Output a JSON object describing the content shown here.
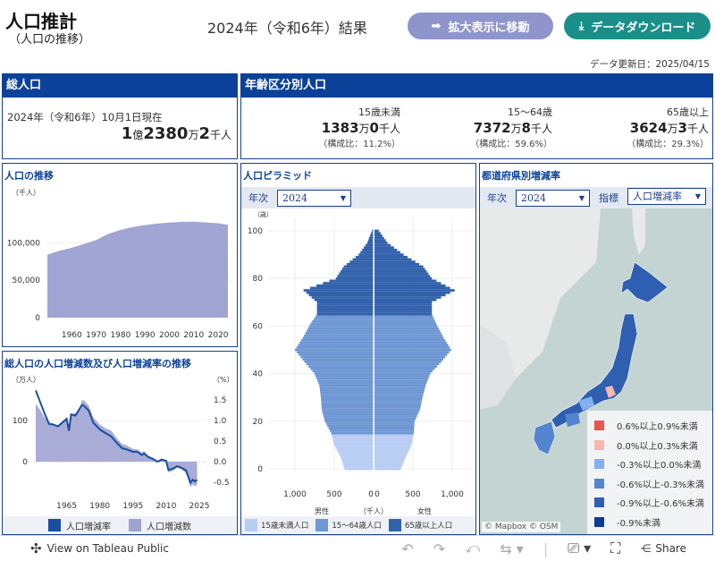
{
  "header": {
    "title": "人口推計",
    "subtitle": "（人口の推移）",
    "result": "2024年（令和6年）結果",
    "expand_button": "拡大表示に移動",
    "download_button": "データダウンロード",
    "updated": "データ更新日：2025/04/15"
  },
  "total": {
    "heading": "総人口",
    "date": "2024年（令和6年）10月1日現在",
    "oku": "1",
    "oku_unit": "億",
    "man": "2380",
    "man_unit": "万",
    "sen": "2",
    "sen_unit": "千人"
  },
  "age": {
    "heading": "年齢区分別人口",
    "groups": [
      {
        "label": "15歳未満",
        "man": "1383",
        "sen": "0",
        "ratio": "（構成比：11.2%）"
      },
      {
        "label": "15～64歳",
        "man": "7372",
        "sen": "8",
        "ratio": "（構成比：59.6%）"
      },
      {
        "label": "65歳以上",
        "man": "3624",
        "sen": "3",
        "ratio": "（構成比：29.3%）"
      }
    ],
    "man_unit": "万",
    "sen_unit": "千人"
  },
  "chart_data": [
    {
      "type": "area",
      "title": "人口の推移",
      "ylabel": "（千人）",
      "ylim": [
        0,
        135000
      ],
      "yticks": [
        "0",
        "50,000",
        "100,000"
      ],
      "ytick_values": [
        0,
        50000,
        100000
      ],
      "xticks": [
        "1960",
        "1970",
        "1980",
        "1990",
        "2000",
        "2010",
        "2020"
      ],
      "color": "#a1a5d3",
      "x": [
        1950,
        1955,
        1960,
        1965,
        1970,
        1975,
        1980,
        1985,
        1990,
        1995,
        2000,
        2005,
        2010,
        2015,
        2020,
        2024
      ],
      "values": [
        84100,
        89300,
        93400,
        98300,
        103700,
        111900,
        117100,
        121000,
        123600,
        125600,
        126900,
        127800,
        128100,
        127100,
        126100,
        123800
      ]
    },
    {
      "type": "line",
      "title": "総人口の人口増減数及び人口増減率の推移",
      "ylabel_left": "（万人）",
      "ylabel_right": "（%）",
      "yticks_left": [
        "0",
        "100"
      ],
      "yticks_right": [
        "-0.5",
        "0.0",
        "0.5",
        "1.0",
        "1.5"
      ],
      "xticks": [
        "1965",
        "1980",
        "1995",
        "2010",
        "2025"
      ],
      "ylim_right": [
        -0.8,
        1.85
      ],
      "x": [
        1951,
        1953,
        1955,
        1957,
        1959,
        1961,
        1963,
        1965,
        1966,
        1967,
        1969,
        1971,
        1972,
        1973,
        1975,
        1977,
        1980,
        1983,
        1985,
        1988,
        1990,
        1992,
        1995,
        1997,
        1999,
        2000,
        2002,
        2004,
        2006,
        2008,
        2010,
        2011,
        2013,
        2015,
        2017,
        2019,
        2021,
        2022,
        2023,
        2024
      ],
      "series": [
        {
          "name": "人口増減率",
          "color": "#1a4ea0",
          "values": [
            1.73,
            1.45,
            1.17,
            0.92,
            0.9,
            0.86,
            0.95,
            1.04,
            0.75,
            1.15,
            1.12,
            1.3,
            1.38,
            1.35,
            1.24,
            0.95,
            0.78,
            0.68,
            0.62,
            0.44,
            0.33,
            0.3,
            0.24,
            0.24,
            0.16,
            0.2,
            0.11,
            0.07,
            0.0,
            0.05,
            0.02,
            -0.2,
            -0.17,
            -0.11,
            -0.15,
            -0.21,
            -0.51,
            -0.44,
            -0.48,
            -0.44
          ]
        },
        {
          "name": "人口増減数",
          "color": "#9fa3d1",
          "values": [
            141,
            125,
            107,
            95,
            93,
            86,
            94,
            105,
            80,
            116,
            118,
            133,
            150,
            148,
            136,
            108,
            90,
            80,
            76,
            55,
            43,
            40,
            31,
            30,
            22,
            26,
            14,
            9,
            2,
            8,
            3,
            -26,
            -22,
            -14,
            -19,
            -28,
            -62,
            -55,
            -60,
            -55
          ]
        }
      ]
    },
    {
      "type": "bar",
      "title": "人口ピラミッド",
      "filter_label": "年次",
      "filter_value": "2024",
      "ylabel": "（歳）",
      "xlabel": "（千人）",
      "male_label": "男性",
      "female_label": "女性",
      "yticks": [
        "0",
        "20",
        "40",
        "60",
        "80",
        "100"
      ],
      "xticks_left": [
        "1,000",
        "500",
        "0"
      ],
      "xticks_right": [
        "0",
        "500",
        "1,000"
      ],
      "ages": [
        0,
        5,
        10,
        15,
        20,
        25,
        30,
        35,
        40,
        45,
        50,
        55,
        60,
        65,
        70,
        75,
        80,
        85,
        90,
        95,
        100
      ],
      "male": [
        370,
        420,
        500,
        540,
        620,
        660,
        670,
        690,
        750,
        880,
        1000,
        900,
        820,
        720,
        720,
        890,
        480,
        380,
        190,
        80,
        20
      ],
      "female": [
        335,
        400,
        470,
        500,
        510,
        580,
        610,
        650,
        710,
        850,
        975,
        880,
        800,
        730,
        730,
        1020,
        730,
        620,
        370,
        165,
        55
      ],
      "legend": [
        {
          "label": "15歳未満人口",
          "color": "#b8cdf3"
        },
        {
          "label": "15～64歳人口",
          "color": "#6e97d3"
        },
        {
          "label": "65歳以上人口",
          "color": "#3262ab"
        }
      ]
    }
  ],
  "map": {
    "title": "都道府県別増減率",
    "year_label": "年次",
    "year_value": "2024",
    "indicator_label": "指標",
    "indicator_value": "人口増減率",
    "attribution": "© Mapbox  © OSM",
    "legend": [
      {
        "label": "0.6%以上0.9%未満",
        "color": "#e9564c"
      },
      {
        "label": "0.0%以上0.3%未満",
        "color": "#f7b9ad"
      },
      {
        "label": "-0.3%以上0.0%未満",
        "color": "#84b0f2"
      },
      {
        "label": "-0.6%以上-0.3%未満",
        "color": "#5484cf"
      },
      {
        "label": "-0.9%以上-0.6%未満",
        "color": "#2e5fb0"
      },
      {
        "label": "-0.9%未満",
        "color": "#0a3b96"
      }
    ]
  },
  "toolbar": {
    "view_label": "View on Tableau Public",
    "share_label": "Share"
  }
}
